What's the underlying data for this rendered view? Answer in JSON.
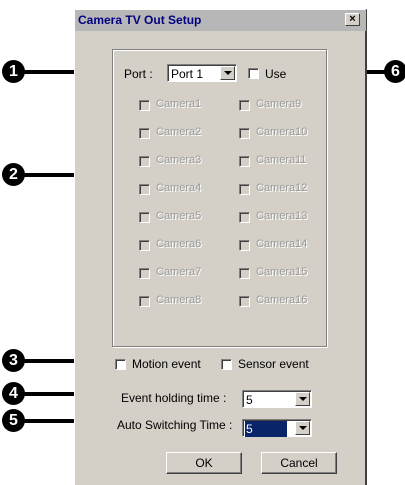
{
  "window": {
    "title": "Camera TV Out Setup",
    "close_label": "×"
  },
  "port": {
    "label": "Port :",
    "value": "Port 1",
    "use_label": "Use"
  },
  "cameras_left": [
    "Camera1",
    "Camera2",
    "Camera3",
    "Camera4",
    "Camera5",
    "Camera6",
    "Camera7",
    "Camera8"
  ],
  "cameras_right": [
    "Camera9",
    "Camera10",
    "Camera11",
    "Camera12",
    "Camera13",
    "Camera14",
    "Camera15",
    "Camera16"
  ],
  "events": {
    "motion_label": "Motion event",
    "sensor_label": "Sensor event"
  },
  "holding": {
    "label": "Event holding time :",
    "value": "5"
  },
  "switching": {
    "label": "Auto Switching Time :",
    "value": "5"
  },
  "buttons": {
    "ok": "OK",
    "cancel": "Cancel"
  },
  "callouts": [
    "1",
    "2",
    "3",
    "4",
    "5",
    "6"
  ]
}
